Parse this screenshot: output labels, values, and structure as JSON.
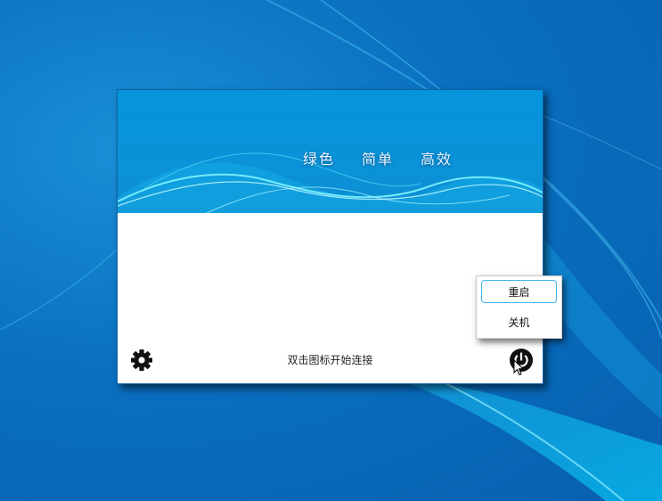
{
  "banner": {
    "slogan": [
      "绿色",
      "简单",
      "高效"
    ]
  },
  "footer": {
    "settings_icon": "gear-icon",
    "status_text": "双击图标开始连接",
    "power_icon": "power-icon"
  },
  "power_menu": {
    "items": [
      {
        "label": "重启",
        "highlighted": true
      },
      {
        "label": "关机",
        "highlighted": false
      }
    ]
  },
  "colors": {
    "banner": "#0594dc",
    "menu_highlight_border": "#39b4ea",
    "desktop": "#0a6fc0"
  }
}
